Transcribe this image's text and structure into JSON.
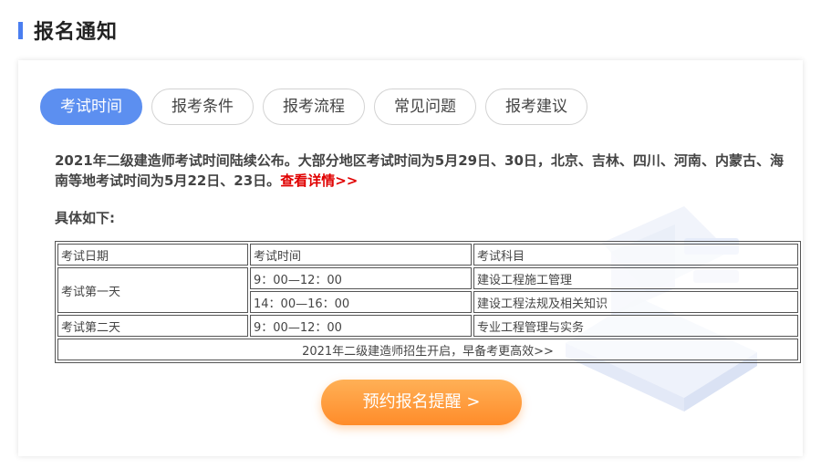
{
  "section": {
    "title": "报名通知"
  },
  "tabs": [
    {
      "label": "考试时间",
      "active": true
    },
    {
      "label": "报考条件",
      "active": false
    },
    {
      "label": "报考流程",
      "active": false
    },
    {
      "label": "常见问题",
      "active": false
    },
    {
      "label": "报考建议",
      "active": false
    }
  ],
  "notice": {
    "text": "2021年二级建造师考试时间陆续公布。大部分地区考试时间为5月29日、30日，北京、吉林、四川、河南、内蒙古、海南等地考试时间为5月22日、23日。",
    "link": "查看详情>>"
  },
  "detail_label": "具体如下:",
  "table": {
    "headers": [
      "考试日期",
      "考试时间",
      "考试科目"
    ],
    "day1": {
      "date": "考试第一天",
      "time1": "9：00—12：00",
      "subject1": "建设工程施工管理",
      "time2": "14：00—16：00",
      "subject2": "建设工程法规及相关知识"
    },
    "day2": {
      "date": "考试第二天",
      "time1": "9：00—12：00",
      "subject1": "专业工程管理与实务"
    },
    "footer": "2021年二级建造师招生开启，早备考更高效>>"
  },
  "cta": {
    "label": "预约报名提醒 >"
  },
  "colors": {
    "accent": "#5c8ff0",
    "link": "#e00000",
    "cta": "#ff9a3c"
  }
}
